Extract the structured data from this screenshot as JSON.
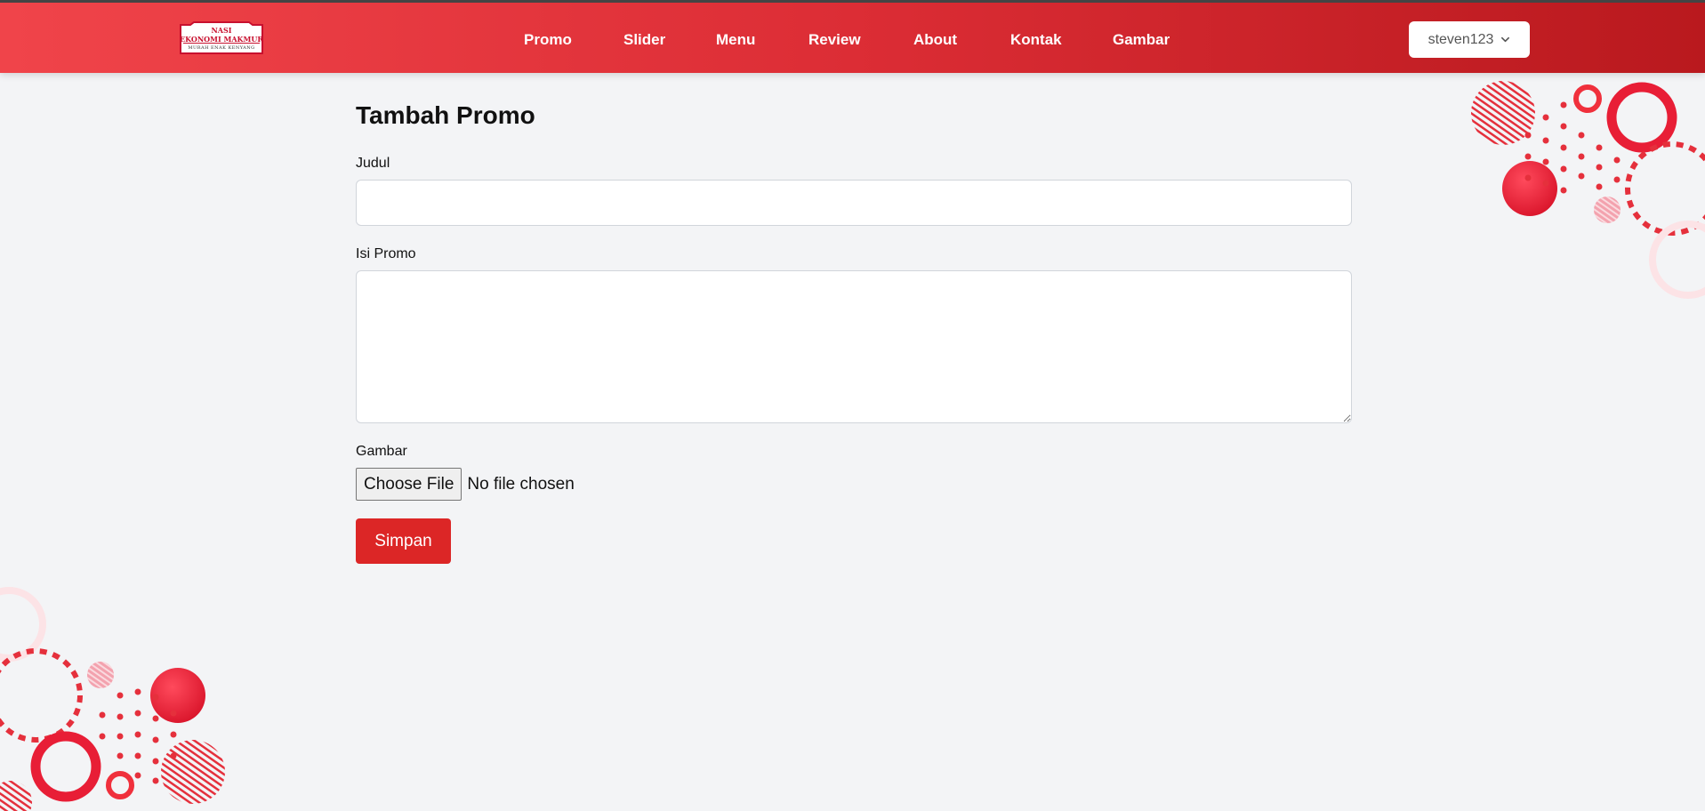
{
  "logo": {
    "line1": "NASI",
    "line2": "EKONOMI MAKMUR",
    "line3": "MURAH ENAK KENYANG"
  },
  "nav": {
    "items": [
      {
        "label": "Promo"
      },
      {
        "label": "Slider"
      },
      {
        "label": "Menu"
      },
      {
        "label": "Review"
      },
      {
        "label": "About"
      },
      {
        "label": "Kontak"
      },
      {
        "label": "Gambar"
      }
    ]
  },
  "user": {
    "name": "steven123"
  },
  "form": {
    "title": "Tambah Promo",
    "judul_label": "Judul",
    "judul_value": "",
    "isi_label": "Isi Promo",
    "isi_value": "",
    "gambar_label": "Gambar",
    "file_button": "Choose File",
    "file_status": "No file chosen",
    "submit_label": "Simpan"
  },
  "colors": {
    "header_start": "#f0444a",
    "header_end": "#b9191e",
    "submit": "#dc2626",
    "background": "#f3f4f6"
  }
}
